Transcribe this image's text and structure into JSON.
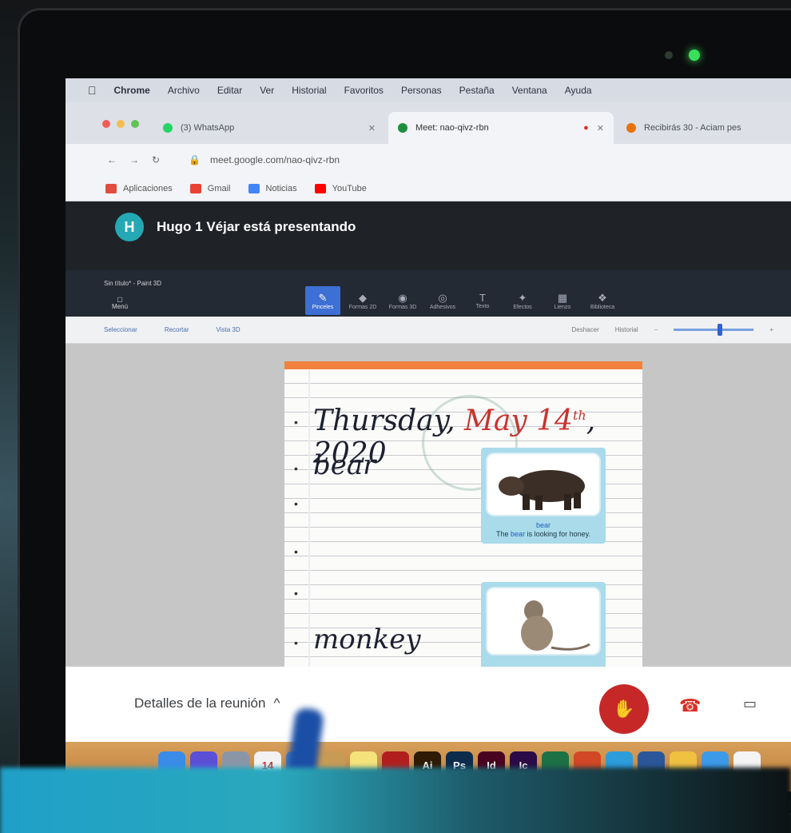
{
  "menubar": {
    "items": [
      "Chrome",
      "Archivo",
      "Editar",
      "Ver",
      "Historial",
      "Favoritos",
      "Personas",
      "Pestaña",
      "Ventana",
      "Ayuda"
    ]
  },
  "tabs": [
    {
      "label": "(3) WhatsApp",
      "active": false,
      "favicon_color": "#25d366"
    },
    {
      "label": "Meet: nao-qivz-rbn",
      "active": true,
      "favicon_color": "#1e8e3e"
    },
    {
      "label": "Recibirás 30 - Aciam pes",
      "active": false,
      "favicon_color": "#e8710a"
    }
  ],
  "address": {
    "url": "meet.google.com/nao-qivz-rbn"
  },
  "bookmarks": [
    {
      "label": "Aplicaciones",
      "color": "#e14d3f"
    },
    {
      "label": "Gmail",
      "color": "#ea4335"
    },
    {
      "label": "Noticias",
      "color": "#4285f4"
    },
    {
      "label": "YouTube",
      "color": "#ff0000"
    }
  ],
  "meet": {
    "avatar_letter": "H",
    "presenting_text": "Hugo 1 Véjar está presentando",
    "details_label": "Detalles de la reunión",
    "accent_red": "#c62828"
  },
  "shared_app": {
    "title": "Sin título* - Paint 3D",
    "menu_label": "Menú",
    "tools": [
      "Pinceles",
      "Formas 2D",
      "Formas 3D",
      "Adhesivos",
      "Texto",
      "Efectos",
      "Lienzo",
      "Biblioteca"
    ],
    "sub_left": [
      "Seleccionar",
      "Recortar",
      "Vista 3D"
    ],
    "sub_right": [
      "Deshacer",
      "Historial"
    ],
    "zoom": 0.58
  },
  "notebook": {
    "date_black": "Thursday, ",
    "date_red": "May 14",
    "date_sup": "th",
    "date_year": ", 2020",
    "word1": "bear",
    "word2": "monkey",
    "card1_title": "bear",
    "card1_sentence_a": "The ",
    "card1_sentence_b": "bear",
    "card1_sentence_c": " is looking for honey."
  },
  "dock": {
    "icons": [
      {
        "name": "finder-icon",
        "label": "",
        "color": "#3b8be8"
      },
      {
        "name": "siri-icon",
        "label": "",
        "color": "#5b4fd6"
      },
      {
        "name": "launchpad-icon",
        "label": "",
        "color": "#8a96a8"
      },
      {
        "name": "calendar-icon",
        "label": "14",
        "color": "#f2f2f2"
      },
      {
        "name": "preview-icon",
        "label": "",
        "color": "#4c7fbf"
      },
      {
        "name": "notes-folder-icon",
        "label": "",
        "color": "#c89b54"
      },
      {
        "name": "stickies-icon",
        "label": "",
        "color": "#f5e27a"
      },
      {
        "name": "acrobat-icon",
        "label": "",
        "color": "#b11e1e"
      },
      {
        "name": "illustrator-icon",
        "label": "Ai",
        "color": "#2e1a05"
      },
      {
        "name": "photoshop-icon",
        "label": "Ps",
        "color": "#0d2b4a"
      },
      {
        "name": "indesign-icon",
        "label": "Id",
        "color": "#49021f"
      },
      {
        "name": "incopy-icon",
        "label": "Ic",
        "color": "#2b0b45"
      },
      {
        "name": "excel-icon",
        "label": "",
        "color": "#1e7145"
      },
      {
        "name": "powerpoint-icon",
        "label": "",
        "color": "#d24726"
      },
      {
        "name": "app-store-icon",
        "label": "",
        "color": "#2d9cdb"
      },
      {
        "name": "word-icon",
        "label": "",
        "color": "#2b579a"
      },
      {
        "name": "photos-icon",
        "label": "",
        "color": "#f0c040"
      },
      {
        "name": "messages-icon",
        "label": "",
        "color": "#3d9ae8"
      },
      {
        "name": "textedit-icon",
        "label": "",
        "color": "#f4f4f4"
      }
    ]
  }
}
